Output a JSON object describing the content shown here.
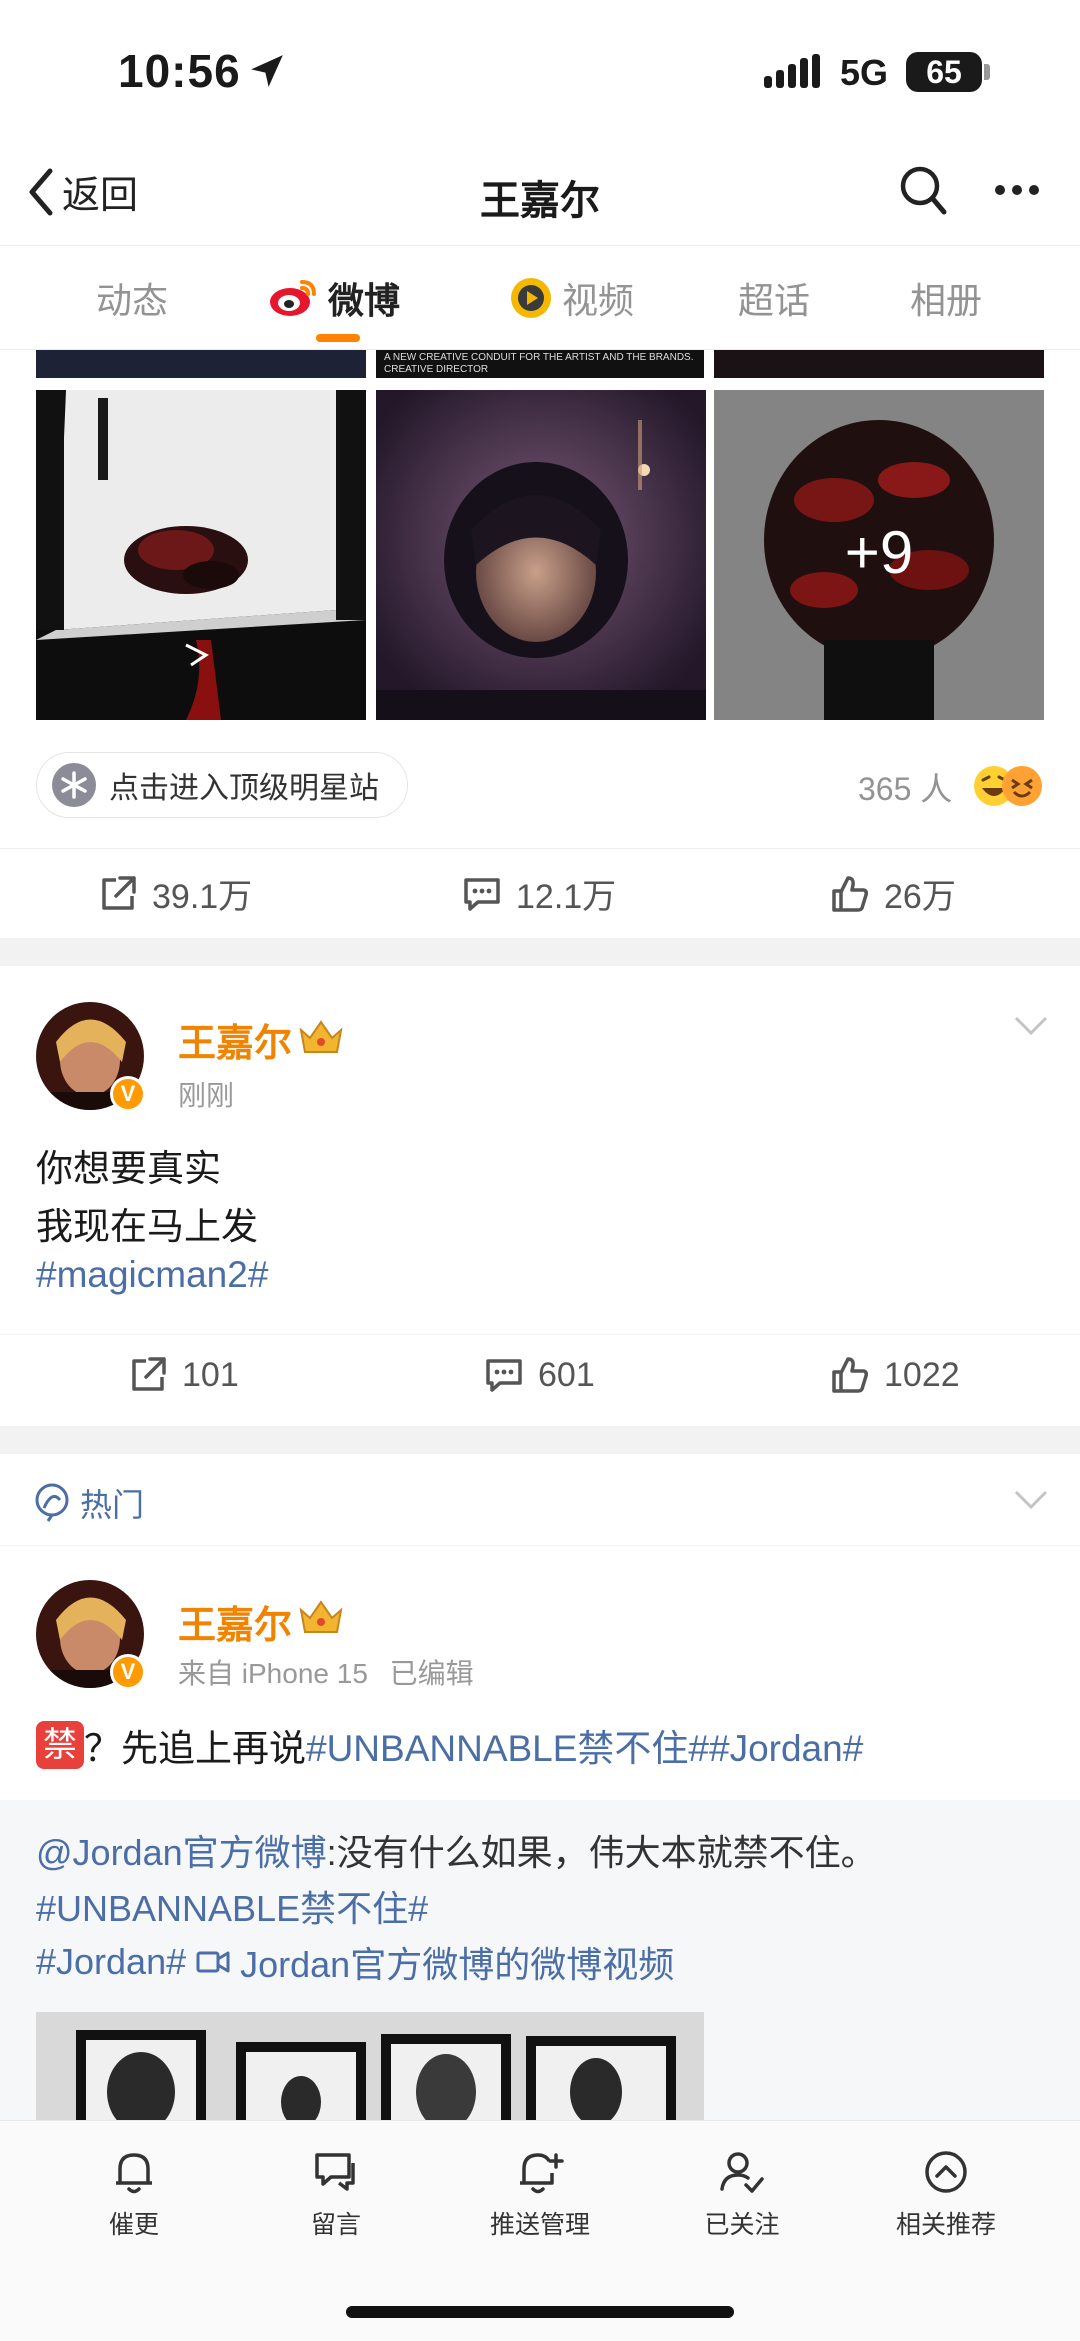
{
  "status_bar": {
    "time": "10:56",
    "network": "5G",
    "battery": "65"
  },
  "nav": {
    "back_label": "返回",
    "title": "王嘉尔"
  },
  "tabs": [
    {
      "label": "动态"
    },
    {
      "label": "微博"
    },
    {
      "label": "视频"
    },
    {
      "label": "超话"
    },
    {
      "label": "相册"
    }
  ],
  "post1": {
    "strip_caption_1": "A NEW CREATIVE CONDUIT FOR THE ARTIST AND THE BRANDS.",
    "strip_caption_2": "CREATIVE DIRECTOR",
    "more_images": "+9",
    "star_site": "点击进入顶级明星站",
    "star_count": "365 人",
    "reposts": "39.1万",
    "comments": "12.1万",
    "likes": "26万"
  },
  "post2": {
    "username": "王嘉尔",
    "time": "刚刚",
    "line1": "你想要真实",
    "line2": "我现在马上发",
    "tag": "#magicman2#",
    "reposts": "101",
    "comments": "601",
    "likes": "1022"
  },
  "hot_section": {
    "label": "热门"
  },
  "post3": {
    "username": "王嘉尔",
    "source": "来自 iPhone 15",
    "edited": "已编辑",
    "emoji_char": "禁",
    "text": "？先追上再说 ",
    "tags": "#UNBANNABLE禁不住##Jordan#",
    "quoted": {
      "author": "@Jordan官方微博",
      "text": ":没有什么如果，伟大本就禁不住。",
      "tag1": "#UNBANNABLE禁不住#",
      "tag2": "#Jordan#",
      "video_link": "Jordan官方微博的微博视频"
    }
  },
  "bottom_bar": [
    {
      "label": "催更",
      "icon": "bell-icon"
    },
    {
      "label": "留言",
      "icon": "message-icon"
    },
    {
      "label": "推送管理",
      "icon": "bell-plus-icon"
    },
    {
      "label": "已关注",
      "icon": "user-check-icon"
    },
    {
      "label": "相关推荐",
      "icon": "chevron-up-circle-icon"
    }
  ],
  "colors": {
    "accent": "#ff8200",
    "username": "#f08300",
    "link": "#4b6ea6"
  }
}
